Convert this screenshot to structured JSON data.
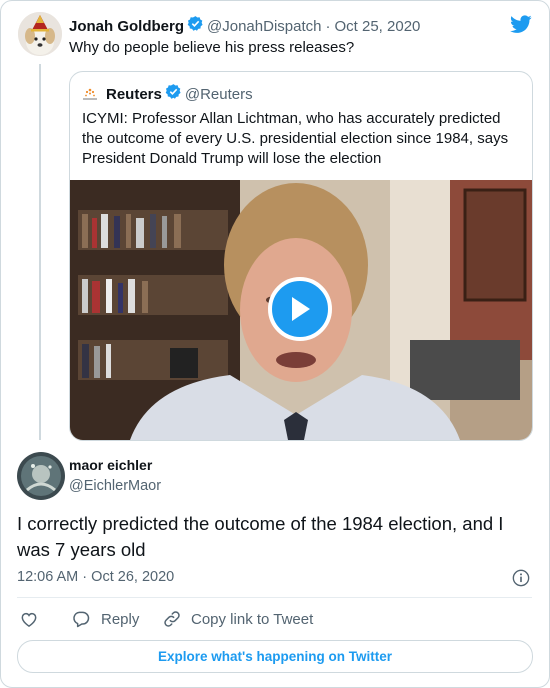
{
  "tweet": {
    "author_name": "Jonah Goldberg",
    "author_handle": "@JonahDispatch",
    "date": "Oct 25, 2020",
    "separator": "·",
    "text": "Why do people believe his press releases?"
  },
  "quoted": {
    "author_name": "Reuters",
    "author_handle": "@Reuters",
    "text": "ICYMI: Professor Allan Lichtman, who has accurately predicted the outcome of every U.S. presidential election since 1984, says President Donald Trump will lose the election"
  },
  "reply": {
    "author_name": "maor eichler",
    "author_handle": "@EichlerMaor",
    "text": "I correctly predicted the outcome of the 1984 election, and I was 7 years old",
    "time": "12:06 AM",
    "separator": "·",
    "date": "Oct 26, 2020"
  },
  "actions": {
    "reply_label": "Reply",
    "copy_label": "Copy link to Tweet"
  },
  "footer": {
    "explore_label": "Explore what's happening on Twitter"
  },
  "colors": {
    "accent": "#1d9bf0",
    "text": "#0f1419",
    "secondary": "#536471",
    "border": "#cfd9de"
  },
  "icons": [
    "twitter-bird-icon",
    "verified-badge-icon",
    "play-icon",
    "info-icon",
    "heart-icon",
    "reply-icon",
    "link-icon"
  ]
}
